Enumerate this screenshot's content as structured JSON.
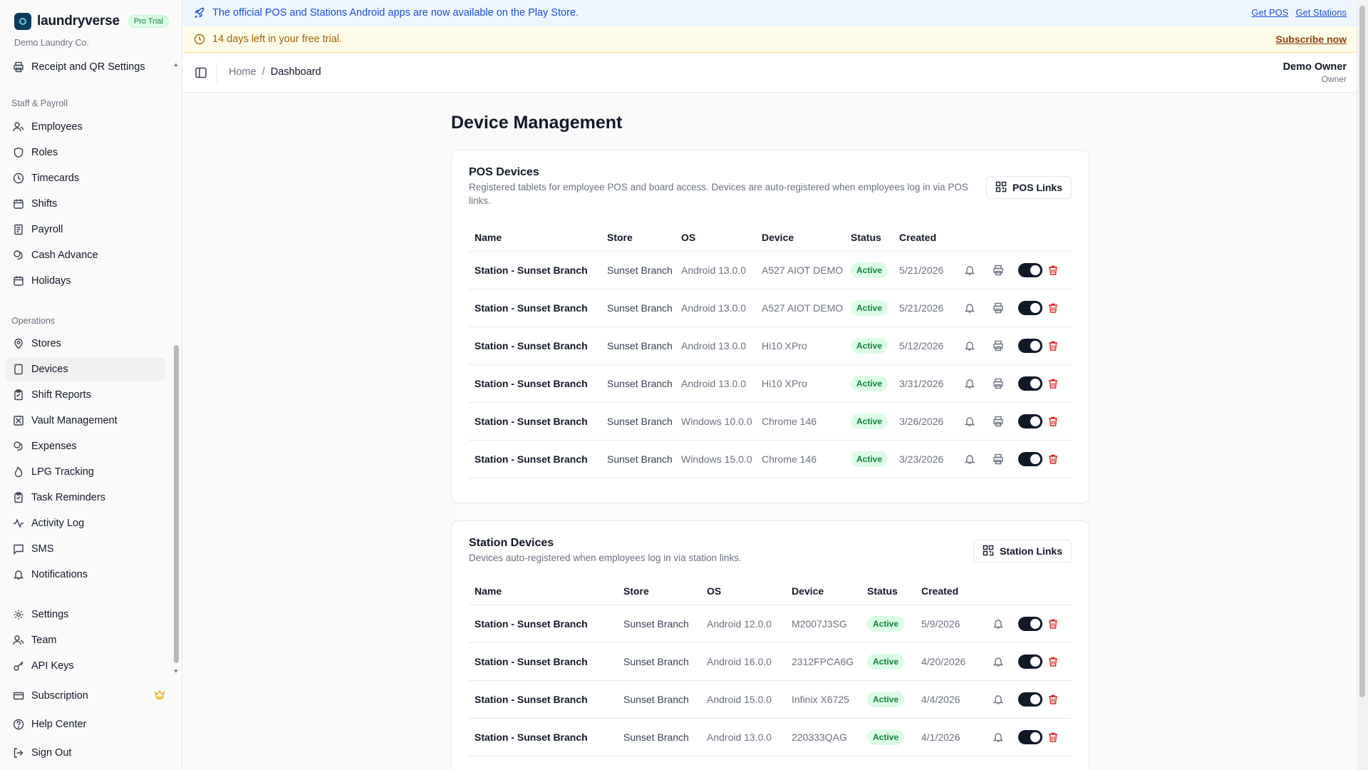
{
  "app": {
    "brand_name": "laundryverse",
    "plan_badge": "Pro Trial",
    "org_name": "Demo Laundry Co."
  },
  "colors": {
    "brand_dark": "#0b3b5a",
    "active_green": "#15803d",
    "danger_red": "#dc2626",
    "info_blue": "#1d4ed8",
    "warning_amber": "#a16207"
  },
  "sidebar": {
    "top_item": {
      "label": "Receipt and QR Settings",
      "icon": "printer-icon"
    },
    "groups": [
      {
        "label": "Staff & Payroll",
        "items": [
          {
            "label": "Employees",
            "icon": "users-icon"
          },
          {
            "label": "Roles",
            "icon": "shield-icon"
          },
          {
            "label": "Timecards",
            "icon": "clock-icon"
          },
          {
            "label": "Shifts",
            "icon": "calendar-icon"
          },
          {
            "label": "Payroll",
            "icon": "receipt-icon"
          },
          {
            "label": "Cash Advance",
            "icon": "coins-icon"
          },
          {
            "label": "Holidays",
            "icon": "calendar-icon"
          }
        ]
      },
      {
        "label": "Operations",
        "items": [
          {
            "label": "Stores",
            "icon": "map-pin-icon"
          },
          {
            "label": "Devices",
            "icon": "tablet-icon",
            "active": true
          },
          {
            "label": "Shift Reports",
            "icon": "clipboard-icon"
          },
          {
            "label": "Vault Management",
            "icon": "vault-icon"
          },
          {
            "label": "Expenses",
            "icon": "coins-icon"
          },
          {
            "label": "LPG Tracking",
            "icon": "flame-icon"
          },
          {
            "label": "Task Reminders",
            "icon": "clipboard-icon"
          },
          {
            "label": "Activity Log",
            "icon": "activity-icon"
          },
          {
            "label": "SMS",
            "icon": "message-icon"
          },
          {
            "label": "Notifications",
            "icon": "bell-icon"
          }
        ]
      },
      {
        "label": "",
        "items": [
          {
            "label": "Settings",
            "icon": "gear-icon"
          },
          {
            "label": "Team",
            "icon": "users-icon"
          },
          {
            "label": "API Keys",
            "icon": "key-icon"
          }
        ]
      }
    ],
    "bottom": [
      {
        "label": "Subscription",
        "icon": "card-icon"
      },
      {
        "label": "Help Center",
        "icon": "help-icon"
      },
      {
        "label": "Sign Out",
        "icon": "logout-icon"
      }
    ]
  },
  "banners": {
    "info_text": "The official POS and Stations Android apps are now available on the Play Store.",
    "get_pos": "Get POS",
    "get_stations": "Get Stations",
    "trial_text": "14 days left in your free trial.",
    "subscribe": "Subscribe now"
  },
  "header": {
    "breadcrumb_home": "Home",
    "breadcrumb_sep": "/",
    "breadcrumb_current": "Dashboard",
    "user_name": "Demo Owner",
    "user_role": "Owner"
  },
  "page": {
    "title": "Device Management"
  },
  "pos": {
    "title": "POS Devices",
    "description_line1": "Registered tablets for employee POS and board access. Devices are auto-registered when employees log in via POS",
    "description_line2": "links.",
    "button_label": "POS Links",
    "columns": [
      "Name",
      "Store",
      "OS",
      "Device",
      "Status",
      "Created"
    ],
    "rows": [
      {
        "name": "Station - Sunset Branch",
        "store": "Sunset Branch",
        "os": "Android 13.0.0",
        "device": "A527 AIOT DEMO",
        "status": "Active",
        "created": "5/21/2026"
      },
      {
        "name": "Station - Sunset Branch",
        "store": "Sunset Branch",
        "os": "Android 13.0.0",
        "device": "A527 AIOT DEMO",
        "status": "Active",
        "created": "5/21/2026"
      },
      {
        "name": "Station - Sunset Branch",
        "store": "Sunset Branch",
        "os": "Android 13.0.0",
        "device": "Hi10 XPro",
        "status": "Active",
        "created": "5/12/2026"
      },
      {
        "name": "Station - Sunset Branch",
        "store": "Sunset Branch",
        "os": "Android 13.0.0",
        "device": "Hi10 XPro",
        "status": "Active",
        "created": "3/31/2026"
      },
      {
        "name": "Station - Sunset Branch",
        "store": "Sunset Branch",
        "os": "Windows 10.0.0",
        "device": "Chrome 146",
        "status": "Active",
        "created": "3/26/2026"
      },
      {
        "name": "Station - Sunset Branch",
        "store": "Sunset Branch",
        "os": "Windows 15.0.0",
        "device": "Chrome 146",
        "status": "Active",
        "created": "3/23/2026"
      }
    ]
  },
  "stations": {
    "title": "Station Devices",
    "description": "Devices auto-registered when employees log in via station links.",
    "button_label": "Station Links",
    "columns": [
      "Name",
      "Store",
      "OS",
      "Device",
      "Status",
      "Created"
    ],
    "rows": [
      {
        "name": "Station - Sunset Branch",
        "store": "Sunset Branch",
        "os": "Android 12.0.0",
        "device": "M2007J3SG",
        "status": "Active",
        "created": "5/9/2026"
      },
      {
        "name": "Station - Sunset Branch",
        "store": "Sunset Branch",
        "os": "Android 16.0.0",
        "device": "2312FPCA6G",
        "status": "Active",
        "created": "4/20/2026"
      },
      {
        "name": "Station - Sunset Branch",
        "store": "Sunset Branch",
        "os": "Android 15.0.0",
        "device": "Infinix X6725",
        "status": "Active",
        "created": "4/4/2026"
      },
      {
        "name": "Station - Sunset Branch",
        "store": "Sunset Branch",
        "os": "Android 13.0.0",
        "device": "220333QAG",
        "status": "Active",
        "created": "4/1/2026"
      }
    ]
  }
}
